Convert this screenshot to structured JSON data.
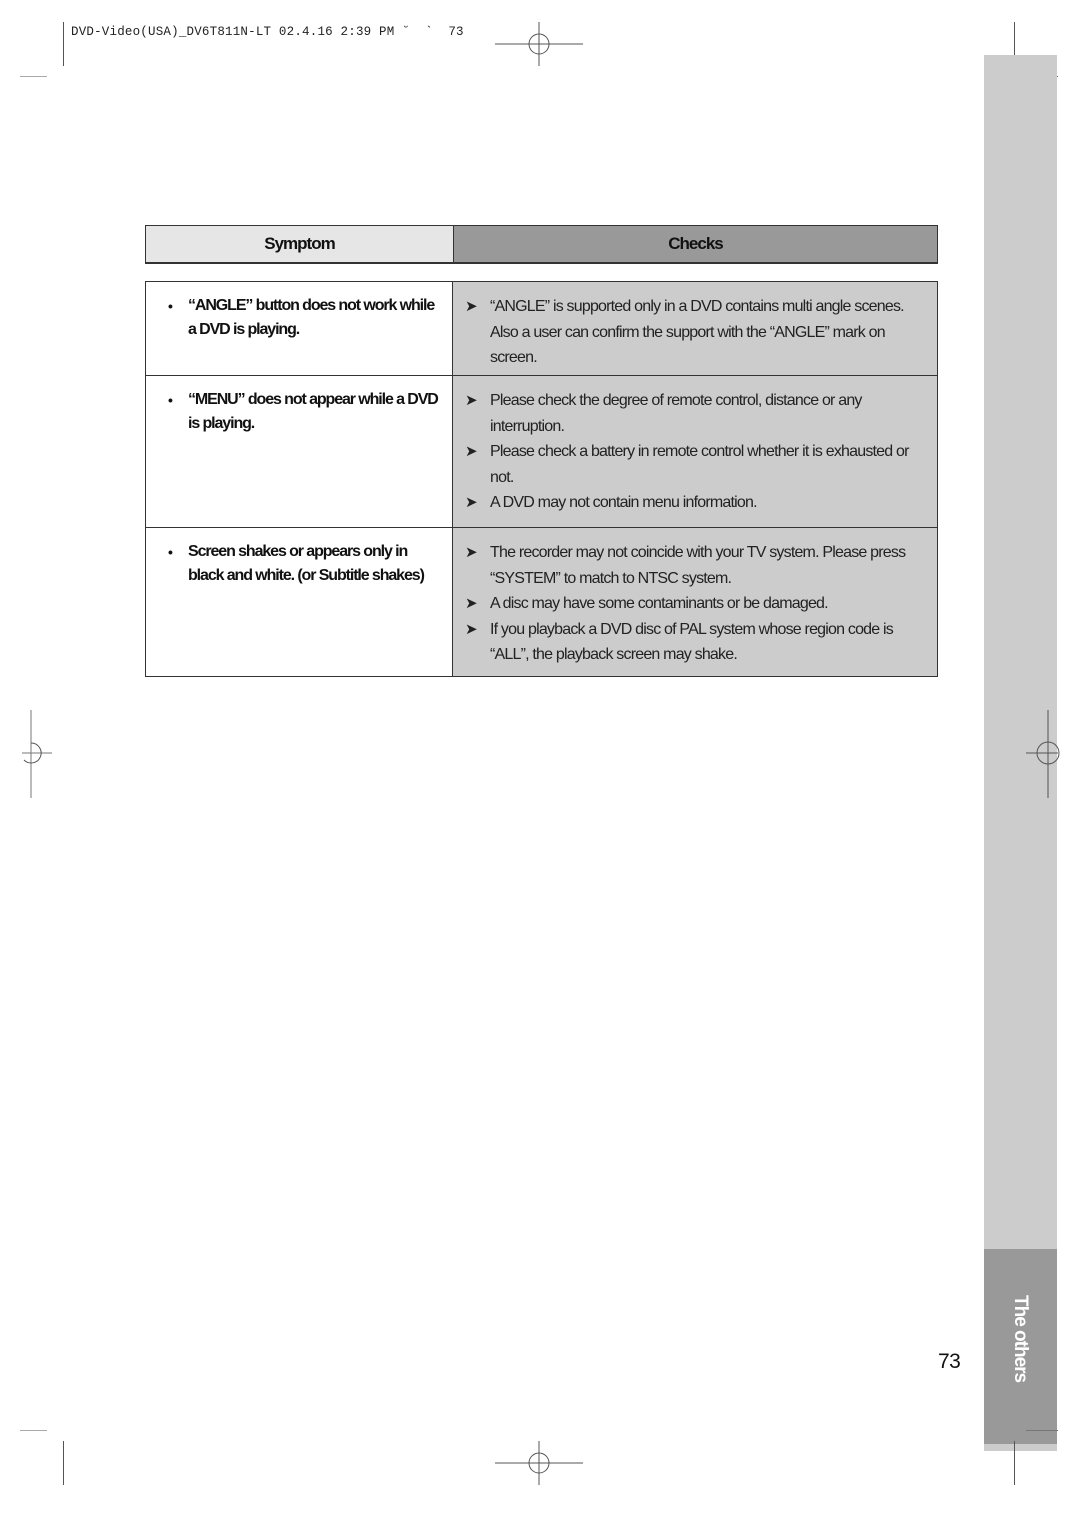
{
  "print_slug": "DVD-Video(USA)_DV6T811N-LT 02.4.16 2:39 PM ˘  `  73",
  "table": {
    "headers": {
      "symptom": "Symptom",
      "checks": "Checks"
    },
    "rows": [
      {
        "symptom": "“ANGLE” button does not work while a DVD is playing.",
        "checks": [
          "“ANGLE” is supported only in a DVD contains multi angle scenes. Also a user can confirm the support with the  “ANGLE” mark on screen."
        ]
      },
      {
        "symptom": "“MENU” does not appear while a DVD is playing.",
        "checks": [
          "Please check the degree of remote control, distance or any interruption.",
          "Please check a battery in remote control whether it is exhausted or not.",
          "A DVD may not contain menu information."
        ]
      },
      {
        "symptom": "Screen shakes or appears only in black and white. (or Subtitle shakes)",
        "checks": [
          "The recorder may not coincide with your TV system. Please press “SYSTEM” to match to NTSC system.",
          "A disc may have some contaminants or be damaged.",
          "If you playback a DVD disc of PAL system whose region code is “ALL”, the playback screen may shake."
        ]
      }
    ]
  },
  "symbols": {
    "bullet": "•",
    "arrow": "➤"
  },
  "side_tab": {
    "label": "The others"
  },
  "page_number": "73",
  "icons": {
    "registration_mark": "registration-mark-icon"
  },
  "colors": {
    "sidebar": "#cccccc",
    "side_tab": "#999999",
    "header_symptom": "#e6e6e6",
    "header_checks": "#999999",
    "checks_cell": "#cccccc"
  }
}
